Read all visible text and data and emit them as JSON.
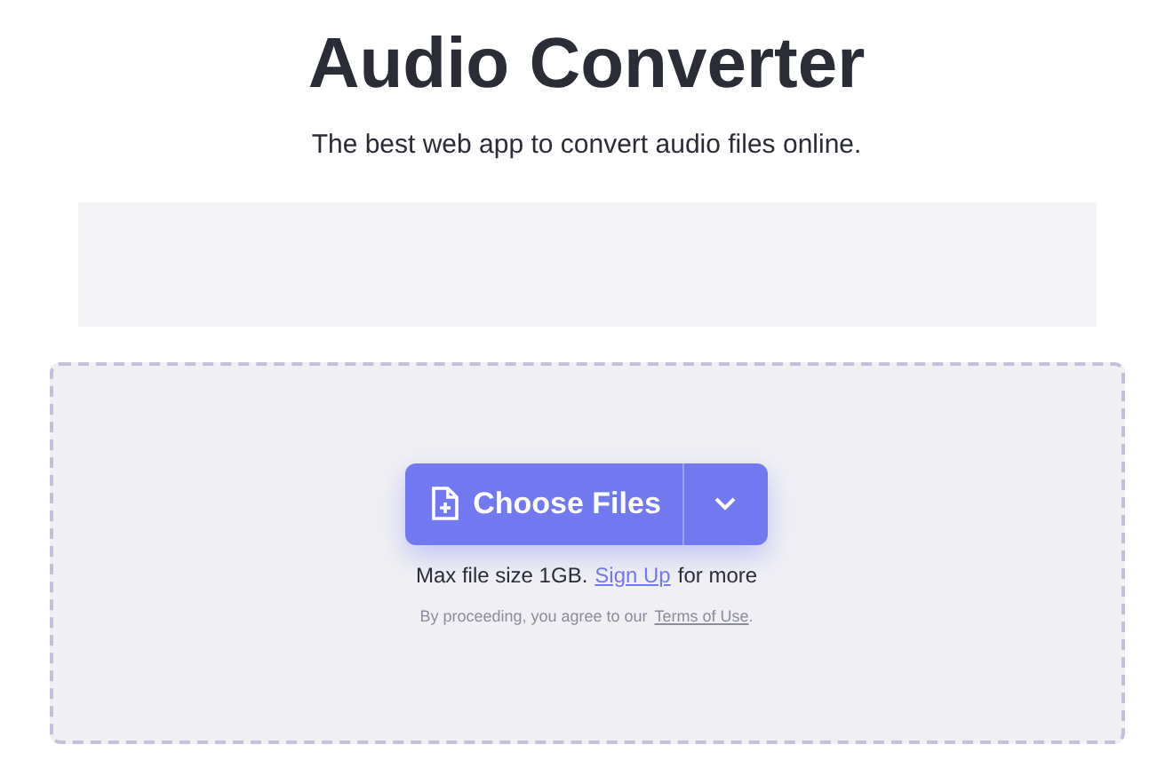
{
  "title": "Audio Converter",
  "subtitle": "The best web app to convert audio files online.",
  "upload": {
    "button": "Choose Files",
    "limit": {
      "before": "Max file size 1GB.",
      "link": "Sign Up",
      "after": "for more"
    },
    "terms": {
      "before": "By proceeding, you agree to our",
      "link": "Terms of Use",
      "after": "."
    }
  }
}
